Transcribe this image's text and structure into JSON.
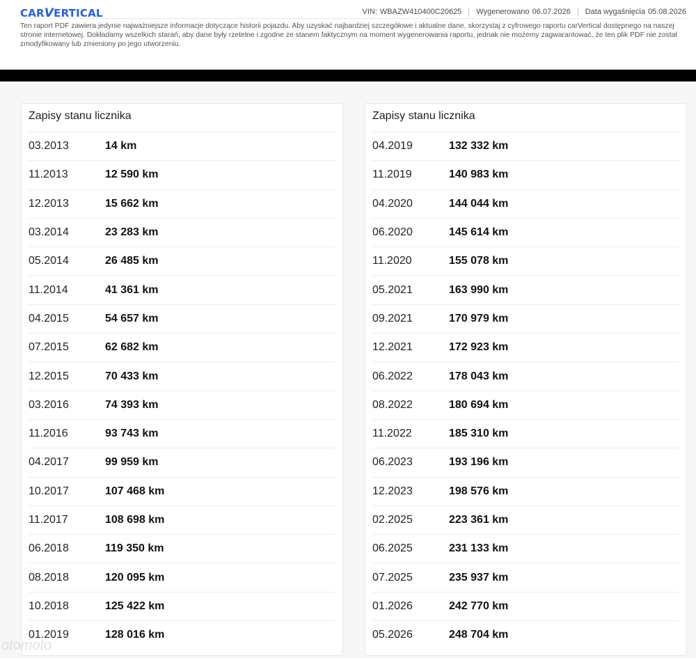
{
  "header": {
    "logo_a": "CAR",
    "logo_v": "V",
    "logo_b": "ERTICAL",
    "vin_label": "VIN:",
    "vin": "WBAZW410400C20625",
    "generated_label": "Wygenerowano",
    "generated": "06.07.2026",
    "expiry_label": "Data wygaśnięcia",
    "expiry": "05.08.2026",
    "disclaimer": "Ten raport PDF zawiera jedynie najważniejsze informacje dotyczące historii pojazdu. Aby uzyskać najbardziej szczegółowe i aktualne dane, skorzystaj z cyfrowego raportu carVertical dostępnego na naszej stronie internetowej. Dokładamy wszelkich starań, aby dane były rzetelne i zgodne ze stanem faktycznym na moment wygenerowania raportu, jednak nie możemy zagwarantować, że ten plik PDF nie został zmodyfikowany lub zmieniony po jego utworzeniu."
  },
  "left_card": {
    "title": "Zapisy stanu licznika",
    "rows": [
      {
        "date": "03.2013",
        "km": "14 km"
      },
      {
        "date": "11.2013",
        "km": "12 590 km"
      },
      {
        "date": "12.2013",
        "km": "15 662 km"
      },
      {
        "date": "03.2014",
        "km": "23 283 km"
      },
      {
        "date": "05.2014",
        "km": "26 485 km"
      },
      {
        "date": "11.2014",
        "km": "41 361 km"
      },
      {
        "date": "04.2015",
        "km": "54 657 km"
      },
      {
        "date": "07.2015",
        "km": "62 682 km"
      },
      {
        "date": "12.2015",
        "km": "70 433 km"
      },
      {
        "date": "03.2016",
        "km": "74 393 km"
      },
      {
        "date": "11.2016",
        "km": "93 743 km"
      },
      {
        "date": "04.2017",
        "km": "99 959 km"
      },
      {
        "date": "10.2017",
        "km": "107 468 km"
      },
      {
        "date": "11.2017",
        "km": "108 698 km"
      },
      {
        "date": "06.2018",
        "km": "119 350 km"
      },
      {
        "date": "08.2018",
        "km": "120 095 km"
      },
      {
        "date": "10.2018",
        "km": "125 422 km"
      },
      {
        "date": "01.2019",
        "km": "128 016 km"
      }
    ]
  },
  "right_card": {
    "title": "Zapisy stanu licznika",
    "rows": [
      {
        "date": "04.2019",
        "km": "132 332 km"
      },
      {
        "date": "11.2019",
        "km": "140 983 km"
      },
      {
        "date": "04.2020",
        "km": "144 044 km"
      },
      {
        "date": "06.2020",
        "km": "145 614 km"
      },
      {
        "date": "11.2020",
        "km": "155 078 km"
      },
      {
        "date": "05.2021",
        "km": "163 990 km"
      },
      {
        "date": "09.2021",
        "km": "170 979 km"
      },
      {
        "date": "12.2021",
        "km": "172 923 km"
      },
      {
        "date": "06.2022",
        "km": "178 043 km"
      },
      {
        "date": "08.2022",
        "km": "180 694 km"
      },
      {
        "date": "11.2022",
        "km": "185 310 km"
      },
      {
        "date": "06.2023",
        "km": "193 196 km"
      },
      {
        "date": "12.2023",
        "km": "198 576 km"
      },
      {
        "date": "02.2025",
        "km": "223 361 km"
      },
      {
        "date": "06.2025",
        "km": "231 133 km"
      },
      {
        "date": "07.2025",
        "km": "235 937 km"
      },
      {
        "date": "01.2026",
        "km": "242 770 km"
      },
      {
        "date": "05.2026",
        "km": "248 704 km"
      }
    ]
  },
  "watermark": "otomoto",
  "colors": {
    "brand": "#2a5fd6",
    "bar": "#000000"
  }
}
